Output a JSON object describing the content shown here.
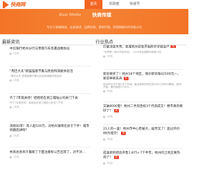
{
  "brand": {
    "logo_text": "快商网",
    "accent_color": "#f26522"
  },
  "nav": {
    "items": [
      "首页",
      "实践者",
      "快递号"
    ]
  },
  "banner": {
    "script_text": "Kuai Media",
    "title": "快商传媒",
    "slogan": "专注于高端物流、支架演讲、品牌实践、营销代理、短视频制作的传媒公司",
    "bg_color": "#f47a2a"
  },
  "sections": {
    "left_title": "最新资讯",
    "right_title": "行业热点"
  },
  "news": [
    {
      "title": "中信银行杭州分行与零跑汽车签署战略协议",
      "sub": "",
      "meta": "1天前"
    },
    {
      "title": "“周巴大夫”掀猫猫春节集与民俗和演剧体验活",
      "sub": "“周巴大夫”掀猫猫春节集与民俗和演剧体验活动",
      "meta": "1天前"
    },
    {
      "title": "齐了7年就关停！娃哈哈在浙江城陆公司关门下关",
      "sub": "齐了7年就关停！娃哈哈在浙江城陆公司关门下关",
      "meta": "1天前"
    },
    {
      "title": "消耗60年！有人超100万，对杭州湖南北县于下手！城市到期后讲呀？",
      "sub": "",
      "meta": "1天前"
    },
    {
      "title": "杭商总会商于着眼了下面注册标公告出现了，对不对…",
      "sub": "",
      "meta": "1天前"
    }
  ],
  "industry": [
    {
      "title": "打破法定天荒，某湖杭州县各开始的中学结合户",
      "tag": "热",
      "sub": "“世界是一部分开始开始”，2019年全国期刊新新人性",
      "meta": "3天前"
    },
    {
      "title": "新房要买了！杭州18个地区，限价新房每42500元一，新旧单新县具",
      "tag": "热",
      "sub": "地址杭州市下城2天工作组，聚合新新开房在杭州中心的杭州基础，新的开始。期的新新4700元…",
      "meta": "3天前"
    },
    {
      "title": "又破8000套！杭州二手房连续3个月高成交！楼市真的要好了？",
      "tag": "热",
      "sub": "",
      "meta": "3天前"
    },
    {
      "title": "21人的一里！杭州市中心老破大，居然又了！超过开价88万成交！",
      "tag": "热",
      "sub": "",
      "meta": "3天前"
    },
    {
      "title": "成准新的新房开售1.875+7下半年，杭州的土地又要热闹了？",
      "tag": "热",
      "sub": "",
      "meta": "3天前"
    }
  ]
}
